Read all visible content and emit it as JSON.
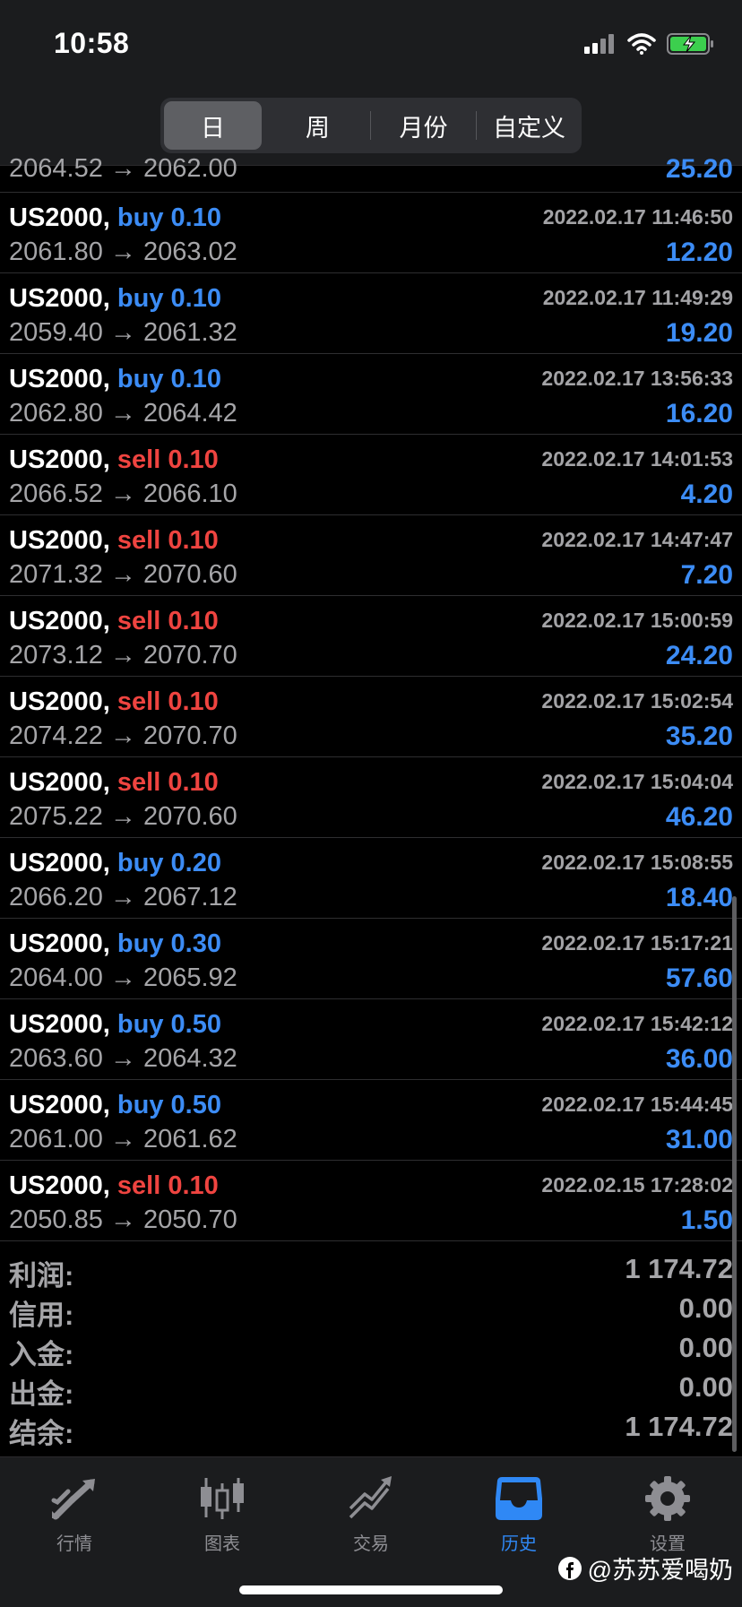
{
  "status_bar": {
    "time": "10:58",
    "signal_icon": "cellular-signal-icon",
    "wifi_icon": "wifi-icon",
    "battery_icon": "battery-charging-icon"
  },
  "period_tabs": [
    {
      "label": "日",
      "active": true
    },
    {
      "label": "周",
      "active": false
    },
    {
      "label": "月份",
      "active": false
    },
    {
      "label": "自定义",
      "active": false
    }
  ],
  "partial_row": {
    "prices": "2064.52 → 2062.00",
    "profit": "25.20"
  },
  "deals": [
    {
      "symbol": "US2000,",
      "side": "buy",
      "volume": "0.10",
      "time": "2022.02.17 11:46:50",
      "prices": "2061.80 → 2063.02",
      "profit": "12.20"
    },
    {
      "symbol": "US2000,",
      "side": "buy",
      "volume": "0.10",
      "time": "2022.02.17 11:49:29",
      "prices": "2059.40 → 2061.32",
      "profit": "19.20"
    },
    {
      "symbol": "US2000,",
      "side": "buy",
      "volume": "0.10",
      "time": "2022.02.17 13:56:33",
      "prices": "2062.80 → 2064.42",
      "profit": "16.20"
    },
    {
      "symbol": "US2000,",
      "side": "sell",
      "volume": "0.10",
      "time": "2022.02.17 14:01:53",
      "prices": "2066.52 → 2066.10",
      "profit": "4.20"
    },
    {
      "symbol": "US2000,",
      "side": "sell",
      "volume": "0.10",
      "time": "2022.02.17 14:47:47",
      "prices": "2071.32 → 2070.60",
      "profit": "7.20"
    },
    {
      "symbol": "US2000,",
      "side": "sell",
      "volume": "0.10",
      "time": "2022.02.17 15:00:59",
      "prices": "2073.12 → 2070.70",
      "profit": "24.20"
    },
    {
      "symbol": "US2000,",
      "side": "sell",
      "volume": "0.10",
      "time": "2022.02.17 15:02:54",
      "prices": "2074.22 → 2070.70",
      "profit": "35.20"
    },
    {
      "symbol": "US2000,",
      "side": "sell",
      "volume": "0.10",
      "time": "2022.02.17 15:04:04",
      "prices": "2075.22 → 2070.60",
      "profit": "46.20"
    },
    {
      "symbol": "US2000,",
      "side": "buy",
      "volume": "0.20",
      "time": "2022.02.17 15:08:55",
      "prices": "2066.20 → 2067.12",
      "profit": "18.40"
    },
    {
      "symbol": "US2000,",
      "side": "buy",
      "volume": "0.30",
      "time": "2022.02.17 15:17:21",
      "prices": "2064.00 → 2065.92",
      "profit": "57.60"
    },
    {
      "symbol": "US2000,",
      "side": "buy",
      "volume": "0.50",
      "time": "2022.02.17 15:42:12",
      "prices": "2063.60 → 2064.32",
      "profit": "36.00"
    },
    {
      "symbol": "US2000,",
      "side": "buy",
      "volume": "0.50",
      "time": "2022.02.17 15:44:45",
      "prices": "2061.00 → 2061.62",
      "profit": "31.00"
    },
    {
      "symbol": "US2000,",
      "side": "sell",
      "volume": "0.10",
      "time": "2022.02.15 17:28:02",
      "prices": "2050.85 → 2050.70",
      "profit": "1.50"
    }
  ],
  "summary": [
    {
      "label": "利润:",
      "value": "1 174.72"
    },
    {
      "label": "信用:",
      "value": "0.00"
    },
    {
      "label": "入金:",
      "value": "0.00"
    },
    {
      "label": "出金:",
      "value": "0.00"
    },
    {
      "label": "结余:",
      "value": "1 174.72"
    }
  ],
  "tabs": [
    {
      "label": "行情",
      "icon": "quotes-arrows-icon",
      "active": false
    },
    {
      "label": "图表",
      "icon": "candlestick-chart-icon",
      "active": false
    },
    {
      "label": "交易",
      "icon": "trade-trend-icon",
      "active": false
    },
    {
      "label": "历史",
      "icon": "inbox-tray-icon",
      "active": true
    },
    {
      "label": "设置",
      "icon": "gear-icon",
      "active": false
    }
  ],
  "watermark": {
    "icon": "facebook-icon",
    "text": "@苏苏爱喝奶"
  },
  "colors": {
    "buy": "#3c8cf5",
    "sell": "#ef4440",
    "accent": "#2f88f5",
    "muted": "#a5a5a8",
    "background": "#000000"
  }
}
